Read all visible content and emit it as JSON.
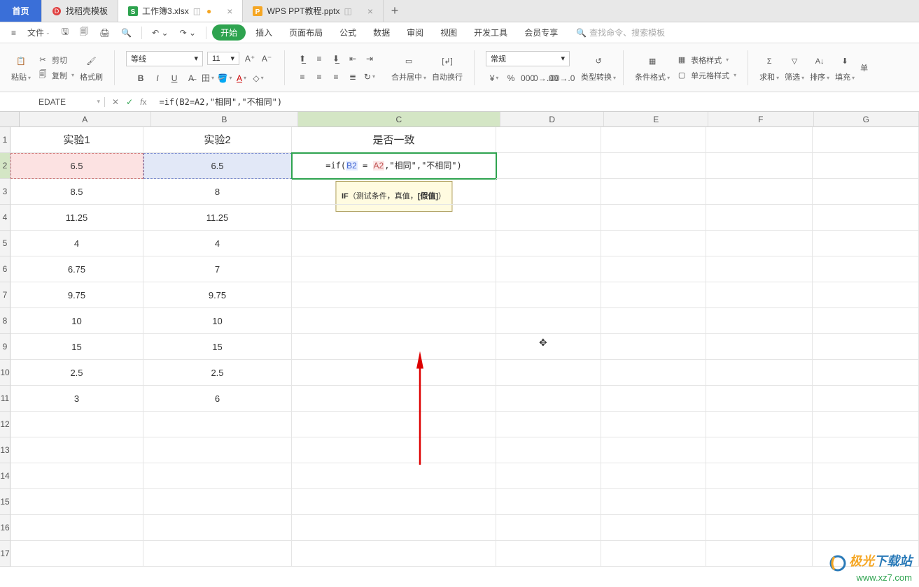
{
  "tabs": {
    "home": "首页",
    "t1": {
      "label": "找稻壳模板",
      "icon_color": "#e04040"
    },
    "t2": {
      "label": "工作簿3.xlsx",
      "icon_color": "#2ea34f",
      "active": true,
      "dirty": "●"
    },
    "t3": {
      "label": "WPS PPT教程.pptx",
      "icon_color": "#f5a623"
    },
    "plus": "+"
  },
  "menubar": {
    "file": "文件",
    "pill": "开始",
    "items": [
      "插入",
      "页面布局",
      "公式",
      "数据",
      "审阅",
      "视图",
      "开发工具",
      "会员专享"
    ],
    "search_placeholder": "查找命令、搜索模板"
  },
  "ribbon": {
    "paste": "粘贴",
    "cut": "剪切",
    "copy": "复制",
    "format_painter": "格式刷",
    "font_name": "等线",
    "font_size": "11",
    "merge": "合并居中",
    "wrap": "自动换行",
    "num_format": "常规",
    "type_convert": "类型转换",
    "cond_format": "条件格式",
    "table_style": "表格样式",
    "cell_style": "单元格样式",
    "sum": "求和",
    "filter": "筛选",
    "sort": "排序",
    "fill": "填充",
    "single": "单"
  },
  "namebox": "EDATE",
  "formula": "=if(B2=A2,\"相同\",\"不相同\")",
  "cols": {
    "widths": [
      190,
      212,
      292,
      150,
      150,
      152,
      152,
      162
    ],
    "labels": [
      "A",
      "B",
      "C",
      "D",
      "E",
      "F",
      "G",
      ""
    ]
  },
  "rows": {
    "labels": [
      "1",
      "2",
      "3",
      "4",
      "5",
      "6",
      "7",
      "8",
      "9",
      "10",
      "11",
      "12",
      "13",
      "14",
      "15",
      "16",
      "17"
    ]
  },
  "headers": {
    "A1": "实验1",
    "B1": "实验2",
    "C1": "是否一致"
  },
  "dataA": [
    "6.5",
    "8.5",
    "11.25",
    "4",
    "6.75",
    "9.75",
    "10",
    "15",
    "2.5",
    "3"
  ],
  "dataB": [
    "6.5",
    "8",
    "11.25",
    "4",
    "7",
    "9.75",
    "10",
    "15",
    "2.5",
    "6"
  ],
  "c2": {
    "prefix": "=if(",
    "b2": "B2",
    "eq": " = ",
    "a2": "A2",
    "rest": ",\"相同\",\"不相同\")"
  },
  "tooltip": {
    "fn": "IF",
    "args": "（测试条件，真值，",
    "bold": "[假值]",
    "end": "）"
  },
  "watermark": {
    "line1a": "极光",
    "line1b": "下载站",
    "line2": "www.xz7.com"
  }
}
